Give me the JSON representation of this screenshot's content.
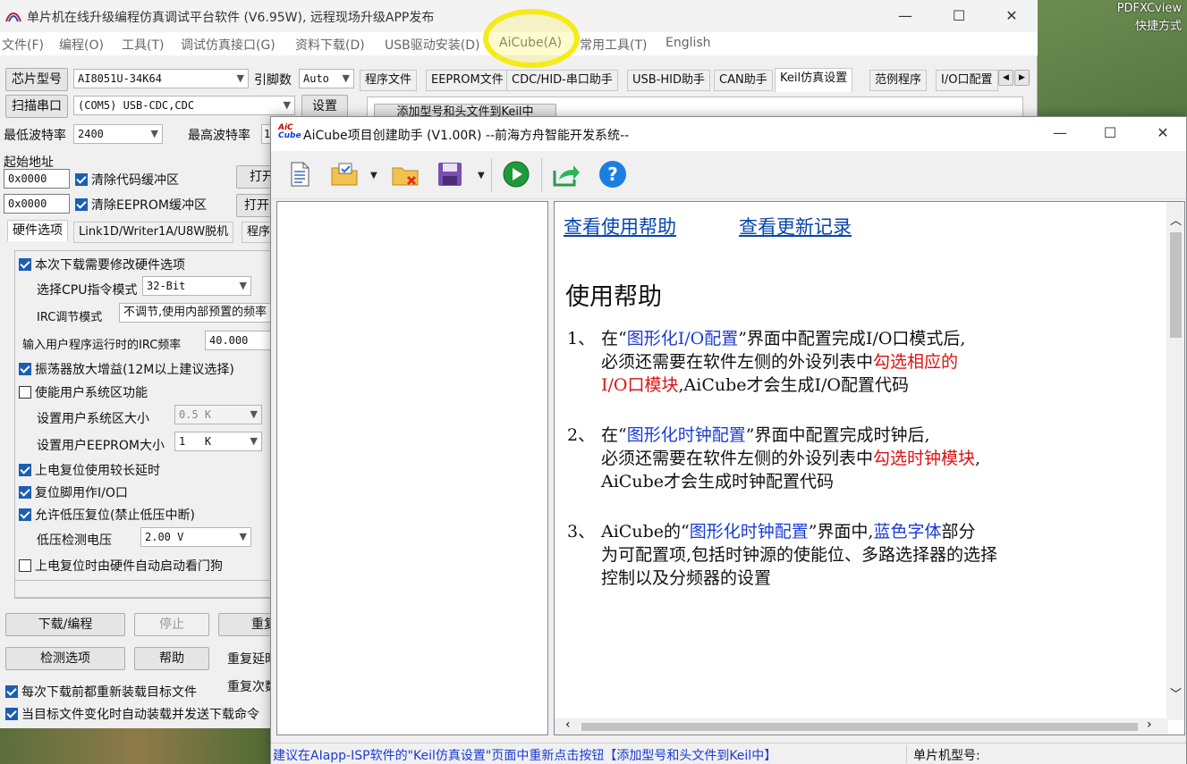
{
  "desktop": {
    "labels": [
      "PDFXCview",
      "快捷方式"
    ]
  },
  "main_window": {
    "title": "单片机在线升级编程仿真调试平台软件 (V6.95W), 远程现场升级APP发布",
    "controls": {
      "minimize": "—",
      "maximize": "☐",
      "close": "✕"
    },
    "menu": [
      "文件(F)",
      "编程(O)",
      "工具(T)",
      "调试仿真接口(G)",
      "资料下载(D)",
      "USB驱动安装(D)",
      "AiCube(A)",
      "常用工具(T)",
      "English"
    ],
    "chip_label": "芯片型号",
    "chip_value": "AI8051U-34K64",
    "pin_label": "引脚数",
    "pin_value": "Auto",
    "scan_label": "扫描串口",
    "port_value": "(COM5) USB-CDC,CDC",
    "settings_btn": "设置",
    "min_baud_label": "最低波特率",
    "min_baud_value": "2400",
    "max_baud_label": "最高波特率",
    "max_baud_value": "1",
    "start_addr_label": "起始地址",
    "addr1": "0x0000",
    "addr2": "0x0000",
    "clear_code": "清除代码缓冲区",
    "clear_eeprom": "清除EEPROM缓冲区",
    "open1": "打开",
    "open2": "打开",
    "right_tabs": [
      "程序文件",
      "EEPROM文件",
      "CDC/HID-串口助手",
      "USB-HID助手",
      "CAN助手",
      "Keil仿真设置",
      "范例程序",
      "I/O口配置"
    ],
    "keil_btn": "添加型号和头文件到Keil中",
    "left_tabs": [
      "硬件选项",
      "Link1D/Writer1A/U8W脱机",
      "程序"
    ],
    "hw": {
      "modify": "本次下载需要修改硬件选项",
      "cpu_mode_label": "选择CPU指令模式",
      "cpu_mode_value": "32-Bit",
      "irc_label": "IRC调节模式",
      "irc_value": "不调节,使用内部预置的频率",
      "freq_label": "输入用户程序运行时的IRC频率",
      "freq_value": "40.000",
      "osc": "振荡器放大增益(12M以上建议选择)",
      "sys_area": "使能用户系统区功能",
      "sys_size_label": "设置用户系统区大小",
      "sys_size_value": "0.5 K",
      "eeprom_label": "设置用户EEPROM大小",
      "eeprom_value": "1   K",
      "power_delay": "上电复位使用较长延时",
      "reset_pin": "复位脚用作I/O口",
      "lvr": "允许低压复位(禁止低压中断)",
      "lvd_label": "低压检测电压",
      "lvd_value": "2.00 V",
      "wdt": "上电复位时由硬件自动启动看门狗"
    },
    "download_btn": "下载/编程",
    "stop_btn": "停止",
    "redo_btn": "重复",
    "detect_btn": "检测选项",
    "help_btn": "帮助",
    "redo_delay": "重复延时",
    "redo_count": "重复次数",
    "reload_each": "每次下载前都重新装载目标文件",
    "auto_reload": "当目标文件变化时自动装载并发送下载命令"
  },
  "aicube": {
    "title": "AiCube项目创建助手 (V1.00R) --前海方舟智能开发系统--",
    "logo": "AiC Cube",
    "toolbar": [
      "new-document-icon",
      "open-folder-icon",
      "delete-folder-icon",
      "save-icon",
      "run-icon",
      "export-icon",
      "help-icon"
    ],
    "links": {
      "help": "查看使用帮助",
      "changelog": "查看更新记录"
    },
    "heading": "使用帮助",
    "items": [
      {
        "num": "1、",
        "lines": [
          [
            {
              "t": "在“",
              "c": ""
            },
            {
              "t": "图形化I/O配置",
              "c": "blue"
            },
            {
              "t": "”界面中配置完成I/O口模式后,",
              "c": ""
            }
          ],
          [
            {
              "t": "必须还需要在软件左侧的外设列表中",
              "c": ""
            },
            {
              "t": "勾选相应的",
              "c": "red"
            }
          ],
          [
            {
              "t": "I/O口模块",
              "c": "red"
            },
            {
              "t": ",AiCube才会生成I/O配置代码",
              "c": ""
            }
          ]
        ]
      },
      {
        "num": "2、",
        "lines": [
          [
            {
              "t": "在“",
              "c": ""
            },
            {
              "t": "图形化时钟配置",
              "c": "blue"
            },
            {
              "t": "”界面中配置完成时钟后,",
              "c": ""
            }
          ],
          [
            {
              "t": "必须还需要在软件左侧的外设列表中",
              "c": ""
            },
            {
              "t": "勾选时钟模块",
              "c": "red"
            },
            {
              "t": ",",
              "c": ""
            }
          ],
          [
            {
              "t": "AiCube才会生成时钟配置代码",
              "c": ""
            }
          ]
        ]
      },
      {
        "num": "3、",
        "lines": [
          [
            {
              "t": "AiCube的“",
              "c": ""
            },
            {
              "t": "图形化时钟配置",
              "c": "blue"
            },
            {
              "t": "”界面中,",
              "c": ""
            },
            {
              "t": "蓝色字体",
              "c": "blue"
            },
            {
              "t": "部分",
              "c": ""
            }
          ],
          [
            {
              "t": "为可配置项,包括时钟源的使能位、多路选择器的选择",
              "c": ""
            }
          ],
          [
            {
              "t": "控制以及分频器的设置",
              "c": ""
            }
          ]
        ]
      }
    ],
    "status": "建议在AIapp-ISP软件的\"Keil仿真设置\"页面中重新点击按钮【添加型号和头文件到Keil中】",
    "status_right": "单片机型号:"
  }
}
